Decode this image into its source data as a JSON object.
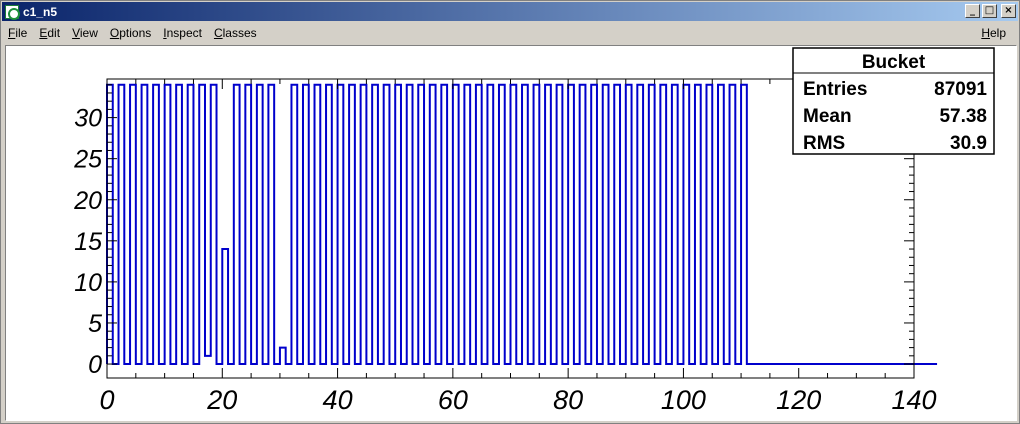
{
  "window": {
    "title": "c1_n5",
    "controls": {
      "minimize": "_",
      "maximize": "□",
      "close": "×"
    }
  },
  "menu": {
    "items": [
      {
        "underline": "F",
        "rest": "ile"
      },
      {
        "underline": "E",
        "rest": "dit"
      },
      {
        "underline": "V",
        "rest": "iew"
      },
      {
        "underline": "O",
        "rest": "ptions"
      },
      {
        "underline": "I",
        "rest": "nspect"
      },
      {
        "underline": "C",
        "rest": "lasses"
      }
    ],
    "help": {
      "underline": "H",
      "rest": "elp"
    }
  },
  "stats": {
    "title": "Bucket",
    "rows": [
      {
        "label": "Entries",
        "value": "87091"
      },
      {
        "label": "Mean",
        "value": "57.38"
      },
      {
        "label": "RMS",
        "value": "30.9"
      }
    ]
  },
  "colors": {
    "histogram": "#0000cc",
    "frame": "#000000"
  },
  "chart_data": {
    "type": "bar",
    "style": "step-histogram",
    "xlim": [
      0,
      140
    ],
    "ylim": [
      -1.7,
      34.7
    ],
    "x_ticks": [
      0,
      20,
      40,
      60,
      80,
      100,
      120,
      140
    ],
    "y_ticks": [
      0,
      5,
      10,
      15,
      20,
      25,
      30
    ],
    "bin_width": 1,
    "values": [
      34,
      0,
      34,
      0,
      34,
      0,
      34,
      0,
      34,
      0,
      34,
      0,
      34,
      0,
      34,
      0,
      34,
      1,
      34,
      0,
      14,
      0,
      34,
      0,
      34,
      0,
      34,
      0,
      34,
      0,
      2,
      0,
      34,
      0,
      34,
      0,
      34,
      0,
      34,
      0,
      34,
      0,
      34,
      0,
      34,
      0,
      34,
      0,
      34,
      0,
      34,
      0,
      34,
      0,
      34,
      0,
      34,
      0,
      34,
      0,
      34,
      0,
      34,
      0,
      34,
      0,
      34,
      0,
      34,
      0,
      34,
      0,
      34,
      0,
      34,
      0,
      34,
      0,
      34,
      0,
      34,
      0,
      34,
      0,
      34,
      0,
      34,
      0,
      34,
      0,
      34,
      0,
      34,
      0,
      34,
      0,
      34,
      0,
      34,
      0,
      34,
      0,
      34,
      0,
      34,
      0,
      34,
      0,
      34,
      0,
      34,
      0,
      0,
      0,
      0,
      0,
      0,
      0,
      0,
      0,
      0,
      0,
      0,
      0,
      0,
      0,
      0,
      0,
      0,
      0,
      0,
      0,
      0,
      0,
      0,
      0,
      0,
      0,
      0,
      0,
      0,
      0,
      0,
      0
    ],
    "title": "",
    "xlabel": "",
    "ylabel": "",
    "grid": false,
    "legend": "none"
  }
}
